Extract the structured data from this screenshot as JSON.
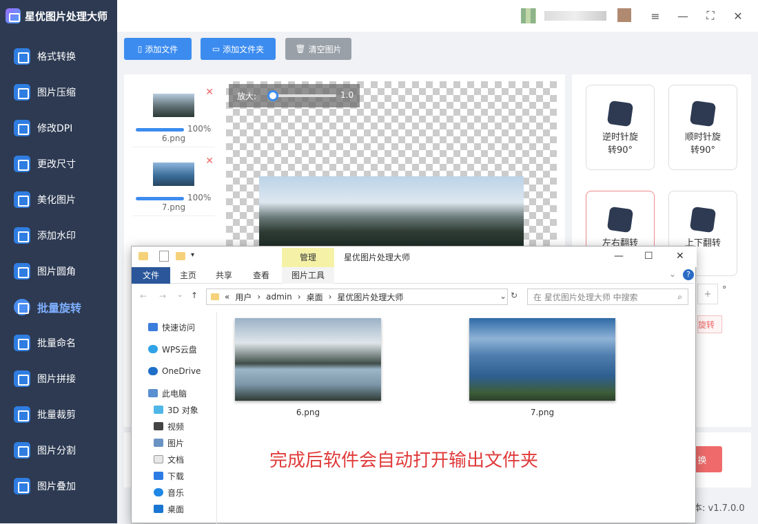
{
  "app": {
    "title": "星优图片处理大师"
  },
  "window_controls": {
    "settings_icon": "≡",
    "minimize": "—",
    "maximize": "⛶",
    "close": "✕"
  },
  "sidebar": {
    "items": [
      {
        "label": "格式转换",
        "active": false
      },
      {
        "label": "图片压缩",
        "active": false
      },
      {
        "label": "修改DPI",
        "active": false
      },
      {
        "label": "更改尺寸",
        "active": false
      },
      {
        "label": "美化图片",
        "active": false
      },
      {
        "label": "添加水印",
        "active": false
      },
      {
        "label": "图片圆角",
        "active": false
      },
      {
        "label": "批量旋转",
        "active": true
      },
      {
        "label": "批量命名",
        "active": false
      },
      {
        "label": "图片拼接",
        "active": false
      },
      {
        "label": "批量裁剪",
        "active": false
      },
      {
        "label": "图片分割",
        "active": false
      },
      {
        "label": "图片叠加",
        "active": false
      }
    ]
  },
  "toolbar": {
    "add_file": "添加文件",
    "add_folder": "添加文件夹",
    "clear": "清空图片"
  },
  "files": [
    {
      "name": "6.png",
      "progress": 100,
      "progress_label": "100%"
    },
    {
      "name": "7.png",
      "progress": 100,
      "progress_label": "100%"
    }
  ],
  "zoom": {
    "label": "放大:",
    "value": "1.0"
  },
  "actions": {
    "ccw_line1": "逆时针旋",
    "ccw_line2": "转90°",
    "cw_line1": "顺时针旋",
    "cw_line2": "转90°",
    "flip_h": "左右翻转",
    "flip_v": "上下翻转",
    "plus": "+",
    "degree": "°",
    "custom_rotate_partial": "旋转"
  },
  "bottom": {
    "start_partial": "换",
    "version": "本:  v1.7.0.0"
  },
  "explorer": {
    "qat_dropdown": "▾",
    "manage_tab": "管理",
    "title": "星优图片处理大师",
    "ribbon": {
      "file": "文件",
      "home": "主页",
      "share": "共享",
      "view": "查看",
      "picture_tools": "图片工具"
    },
    "breadcrumb": [
      "«",
      "用户",
      "admin",
      "桌面",
      "星优图片处理大师"
    ],
    "search_placeholder": "在 星优图片处理大师 中搜索",
    "nav": [
      "快速访问",
      "WPS云盘",
      "OneDrive",
      "此电脑",
      "3D 对象",
      "视频",
      "图片",
      "文档",
      "下载",
      "音乐",
      "桌面"
    ],
    "files": [
      "6.png",
      "7.png"
    ],
    "caption": "完成后软件会自动打开输出文件夹"
  },
  "colors": {
    "sidebar_bg": "#2d3a52",
    "accent_blue": "#3c8cf0",
    "start_red": "#ef6b6b",
    "caption_red": "#e03a3a"
  }
}
